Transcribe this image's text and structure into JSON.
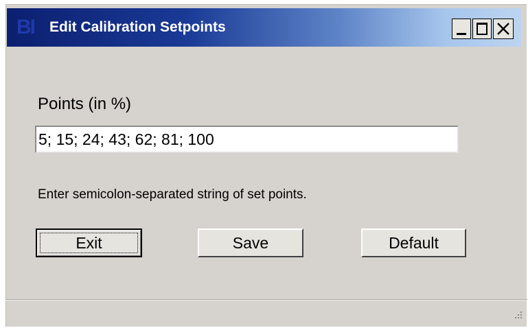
{
  "window": {
    "title": "Edit Calibration Setpoints",
    "logo_text": "BI",
    "controls": {
      "minimize_icon": "minimize-icon",
      "maximize_icon": "maximize-icon",
      "close_icon": "close-icon"
    }
  },
  "form": {
    "points_label": "Points (in %)",
    "points_value": "5; 15; 24; 43; 62; 81; 100",
    "hint": "Enter semicolon-separated string of set points."
  },
  "buttons": {
    "exit_label": "Exit",
    "save_label": "Save",
    "default_label": "Default"
  },
  "colors": {
    "dialog_background": "#d6d3ce",
    "titlebar_start": "#0c1f70",
    "titlebar_end": "#bcd4f0",
    "logo": "#1f3aa8"
  }
}
